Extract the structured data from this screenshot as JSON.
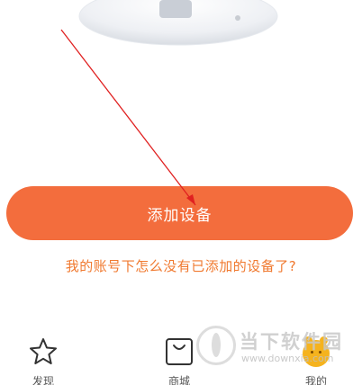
{
  "main": {
    "add_device_label": "添加设备",
    "help_link": "我的账号下怎么没有已添加的设备了?"
  },
  "bottom_nav": {
    "items": [
      {
        "label": "发现",
        "icon": "star-icon"
      },
      {
        "label": "商城",
        "icon": "shopping-bag-icon"
      },
      {
        "label": "我的",
        "icon": "avatar-icon"
      }
    ]
  },
  "watermark": {
    "title": "当下软件园",
    "url": "www.downxia.com"
  },
  "colors": {
    "accent": "#f36d3d",
    "link": "#f0792f",
    "avatar": "#f5b31e",
    "annotation_arrow": "#e02020"
  }
}
